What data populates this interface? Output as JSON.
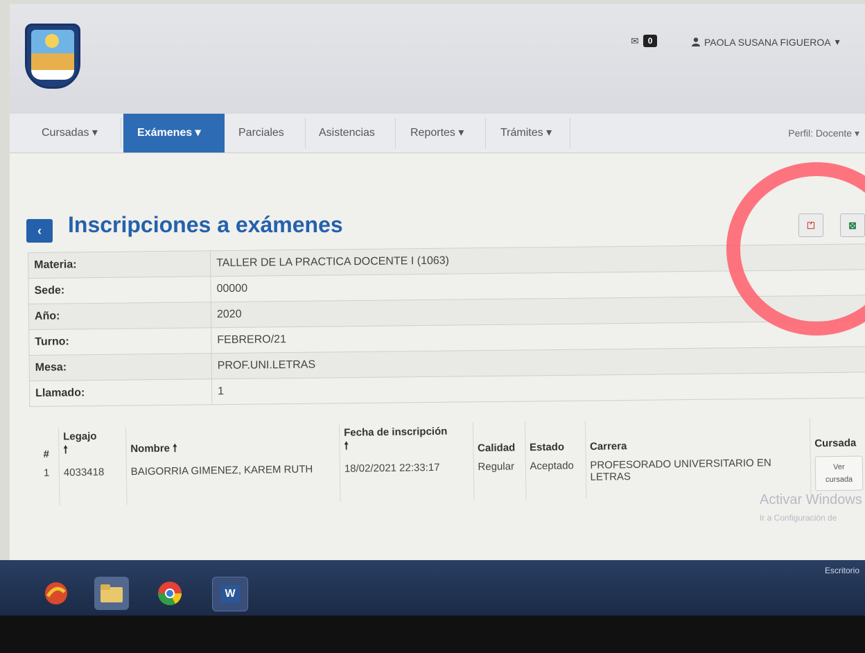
{
  "header": {
    "mail_count": "0",
    "user_name": "PAOLA SUSANA FIGUEROA",
    "user_caret": "▾"
  },
  "nav": {
    "items": [
      {
        "label": "Cursadas ▾"
      },
      {
        "label": "Exámenes ▾"
      },
      {
        "label": "Parciales"
      },
      {
        "label": "Asistencias"
      },
      {
        "label": "Reportes ▾"
      },
      {
        "label": "Trámites ▾"
      }
    ],
    "perfil": "Perfil: Docente ▾"
  },
  "page": {
    "back_symbol": "‹",
    "title": "Inscripciones a exámenes"
  },
  "info": {
    "rows": [
      {
        "label": "Materia:",
        "value": "TALLER DE LA PRACTICA DOCENTE I (1063)"
      },
      {
        "label": "Sede:",
        "value": "00000"
      },
      {
        "label": "Año:",
        "value": "2020"
      },
      {
        "label": "Turno:",
        "value": "FEBRERO/21"
      },
      {
        "label": "Mesa:",
        "value": "PROF.UNI.LETRAS"
      },
      {
        "label": "Llamado:",
        "value": "1"
      }
    ]
  },
  "results": {
    "headers": {
      "num": "#",
      "legajo": "Legajo",
      "nombre": "Nombre",
      "fecha": "Fecha de inscripción",
      "calidad": "Calidad",
      "estado": "Estado",
      "carrera": "Carrera",
      "cursada": "Cursada"
    },
    "sort_arrow": "🠕",
    "rows": [
      {
        "num": "1",
        "legajo": "4033418",
        "nombre": "BAIGORRIA GIMENEZ, KAREM RUTH",
        "fecha": "18/02/2021 22:33:17",
        "calidad": "Regular",
        "estado": "Aceptado",
        "carrera": "PROFESORADO UNIVERSITARIO EN LETRAS",
        "ver_label_1": "Ver",
        "ver_label_2": "cursada"
      }
    ]
  },
  "watermark": {
    "line1": "Activar Windows",
    "line2": "Ir a Configuración de"
  },
  "taskbar": {
    "escritorio": "Escritorio",
    "word_letter": "W"
  },
  "colors": {
    "accent": "#2d6cb5",
    "annotation": "#ff5e6c"
  }
}
